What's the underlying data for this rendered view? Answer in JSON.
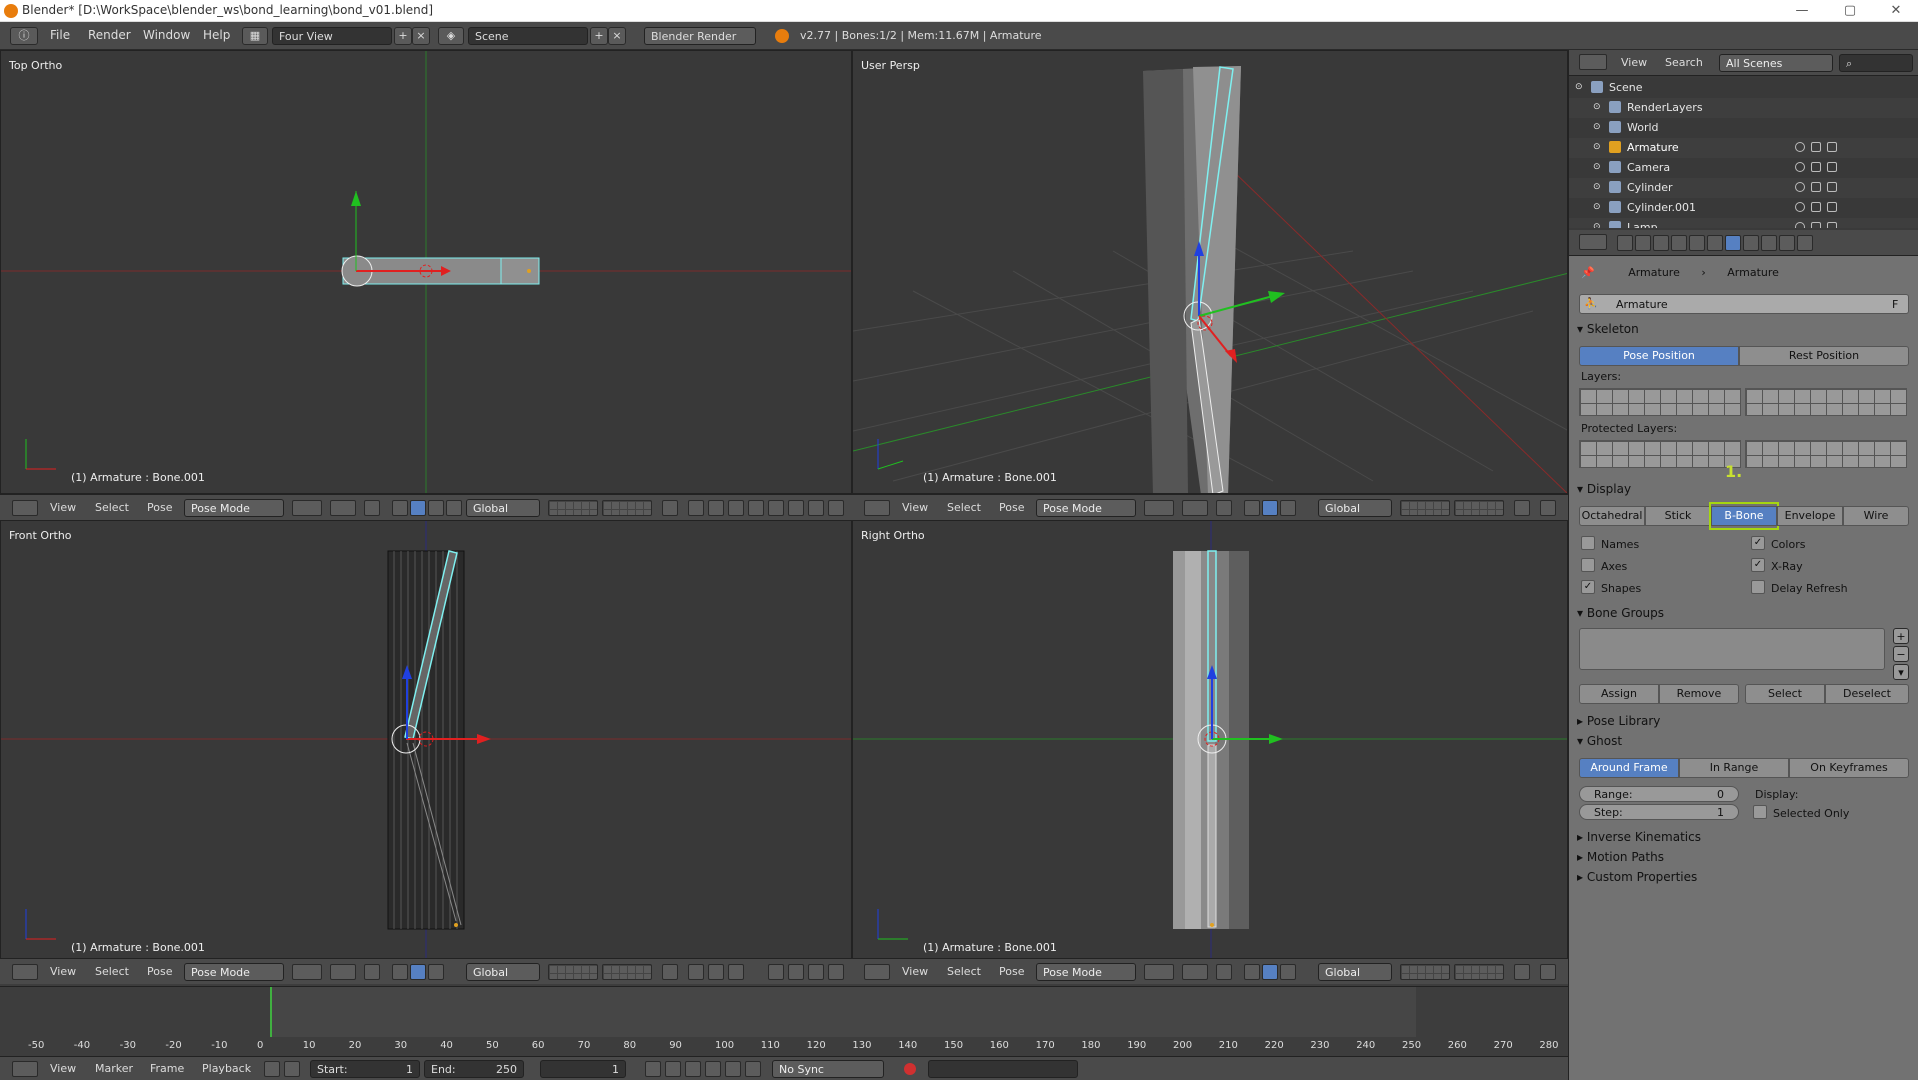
{
  "window": {
    "title": "Blender* [D:\\WorkSpace\\blender_ws\\bond_learning\\bond_v01.blend]",
    "minimize": "—",
    "maximize": "▢",
    "close": "✕"
  },
  "infobar": {
    "menus": [
      "File",
      "Render",
      "Window",
      "Help"
    ],
    "layout": "Four View",
    "scene": "Scene",
    "engine": "Blender Render",
    "stats": "v2.77 | Bones:1/2 | Mem:11.67M | Armature"
  },
  "viewports": [
    {
      "label": "Top Ortho",
      "info": "(1) Armature : Bone.001"
    },
    {
      "label": "User Persp",
      "info": "(1) Armature : Bone.001"
    },
    {
      "label": "Front Ortho",
      "info": "(1) Armature : Bone.001"
    },
    {
      "label": "Right Ortho",
      "info": "(1) Armature : Bone.001"
    }
  ],
  "viewheader": {
    "view": "View",
    "select": "Select",
    "pose": "Pose",
    "mode": "Pose Mode",
    "orientation": "Global"
  },
  "timeline": {
    "ticks": [
      "-50",
      "-40",
      "-30",
      "-20",
      "-10",
      "0",
      "10",
      "20",
      "30",
      "40",
      "50",
      "60",
      "70",
      "80",
      "90",
      "100",
      "110",
      "120",
      "130",
      "140",
      "150",
      "160",
      "170",
      "180",
      "190",
      "200",
      "210",
      "220",
      "230",
      "240",
      "250",
      "260",
      "270",
      "280"
    ],
    "current_frame": 1,
    "menus": [
      "View",
      "Marker",
      "Frame",
      "Playback"
    ],
    "start_label": "Start:",
    "start": "1",
    "end_label": "End:",
    "end": "250",
    "frame": "1",
    "sync": "No Sync"
  },
  "outliner": {
    "view": "View",
    "search": "Search",
    "filter": "All Scenes",
    "items": [
      {
        "name": "Scene",
        "indent": 0
      },
      {
        "name": "RenderLayers",
        "indent": 1
      },
      {
        "name": "World",
        "indent": 1
      },
      {
        "name": "Armature",
        "indent": 1,
        "selected": true
      },
      {
        "name": "Camera",
        "indent": 1
      },
      {
        "name": "Cylinder",
        "indent": 1
      },
      {
        "name": "Cylinder.001",
        "indent": 1
      },
      {
        "name": "Lamp",
        "indent": 1
      }
    ]
  },
  "properties": {
    "breadcrumb_obj": "Armature",
    "breadcrumb_data": "Armature",
    "datablock": "Armature",
    "datablock_f": "F",
    "skeleton": {
      "title": "Skeleton",
      "pose_position": "Pose Position",
      "rest_position": "Rest Position",
      "layers": "Layers:",
      "protected_layers": "Protected Layers:"
    },
    "display": {
      "title": "Display",
      "annotation": "1.",
      "modes": [
        "Octahedral",
        "Stick",
        "B-Bone",
        "Envelope",
        "Wire"
      ],
      "active_mode": "B-Bone",
      "names": "Names",
      "colors": "Colors",
      "axes": "Axes",
      "xray": "X-Ray",
      "shapes": "Shapes",
      "delay_refresh": "Delay Refresh",
      "checked": {
        "names": false,
        "colors": true,
        "axes": false,
        "xray": true,
        "shapes": true,
        "delay_refresh": false
      }
    },
    "bone_groups": {
      "title": "Bone Groups",
      "assign": "Assign",
      "remove": "Remove",
      "select": "Select",
      "deselect": "Deselect"
    },
    "pose_library": "Pose Library",
    "ghost": {
      "title": "Ghost",
      "around_frame": "Around Frame",
      "in_range": "In Range",
      "on_keyframes": "On Keyframes",
      "range_label": "Range:",
      "range": "0",
      "step_label": "Step:",
      "step": "1",
      "display_label": "Display:",
      "selected_only": "Selected Only"
    },
    "inverse_kinematics": "Inverse Kinematics",
    "motion_paths": "Motion Paths",
    "custom_properties": "Custom Properties"
  },
  "colors": {
    "accent": "#5680c2",
    "highlight_box": "#a5d610",
    "annotation": "#c8e030",
    "x_axis": "#e02020",
    "y_axis": "#20c020",
    "z_axis": "#2040e0",
    "bone_outline": "#7ff0f0"
  }
}
